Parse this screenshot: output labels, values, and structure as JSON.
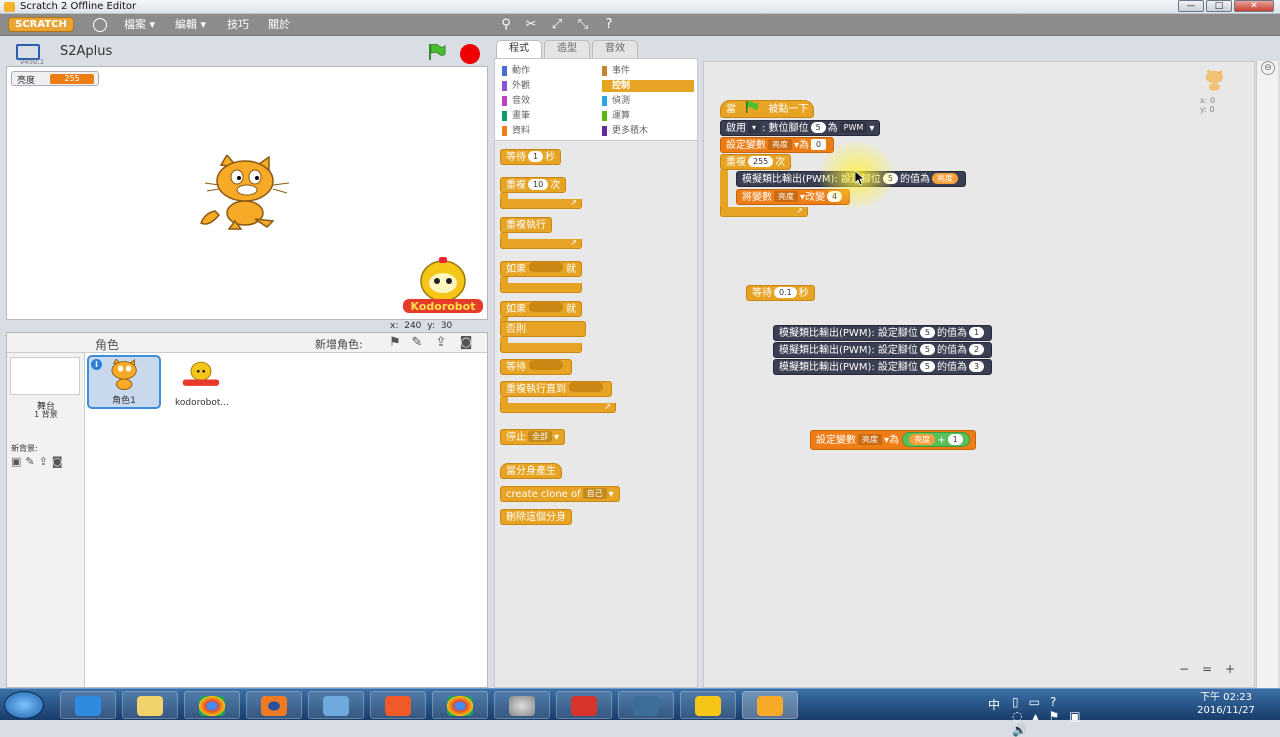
{
  "window": {
    "title": "Scratch 2 Offline Editor",
    "buttons": {
      "minimize": "—",
      "maximize": "□",
      "close": "✕"
    }
  },
  "menubar": {
    "logo": "SCRATCH",
    "menus": [
      "檔案 ▾",
      "編輯 ▾",
      "技巧",
      "關於"
    ],
    "tools": [
      "duplicate-tool",
      "delete-tool",
      "grow-tool",
      "shrink-tool",
      "help-tool"
    ]
  },
  "stage": {
    "project_name": "S2Aplus",
    "version": "v450.1",
    "monitor": {
      "label": "亮度",
      "value": "255"
    },
    "coords": "x: 240   y: 30"
  },
  "sprites": {
    "header": "角色",
    "new_sprite": "新增角色:",
    "stage_name": "舞台",
    "stage_backdrops": "1 背景",
    "new_backdrop": "新背景:",
    "items": [
      {
        "name": "角色1",
        "selected": true
      },
      {
        "name": "kodorobot..."
      }
    ]
  },
  "tabs": [
    "程式",
    "造型",
    "音效"
  ],
  "categories": [
    {
      "label": "動作",
      "color": "#4a6cd4"
    },
    {
      "label": "事件",
      "color": "#c88330"
    },
    {
      "label": "外觀",
      "color": "#8a55d7"
    },
    {
      "label": "控制",
      "color": "#e1a91a",
      "active": true
    },
    {
      "label": "音效",
      "color": "#bb42c3"
    },
    {
      "label": "偵測",
      "color": "#2ca5e2"
    },
    {
      "label": "畫筆",
      "color": "#0e9a6c"
    },
    {
      "label": "運算",
      "color": "#5cb712"
    },
    {
      "label": "資料",
      "color": "#ee7d16"
    },
    {
      "label": "更多積木",
      "color": "#632d99"
    }
  ],
  "palette": {
    "wait": "等待",
    "wait_val": "1",
    "wait_unit": "秒",
    "repeat": "重複",
    "repeat_val": "10",
    "repeat_unit": "次",
    "forever": "重複執行",
    "if": "如果",
    "then": "就",
    "if2": "如果",
    "then2": "就",
    "else": "否則",
    "wait_until": "等待",
    "repeat_until": "重複執行直到",
    "stop": "停止",
    "stop_opt": "全部",
    "clone_start": "當分身產生",
    "create_clone": "create clone of",
    "create_clone_opt": "自己",
    "delete_clone": "刪除這個分身"
  },
  "script": {
    "hat": "當",
    "hat2": "被點一下",
    "enable": "啟用",
    "enable2": ": 數位腳位",
    "enable_pin": "5",
    "enable3": "為",
    "enable_mode": "PWM",
    "setvar": "設定變數",
    "setvar_var": "亮度",
    "setvar_to": "為",
    "setvar_val": "0",
    "repeat": "重複",
    "repeat_val": "255",
    "repeat_unit": "次",
    "analog": "模擬類比輸出(PWM): 設定腳位",
    "analog_pin": "5",
    "analog_to": "的值為",
    "analog_val": "亮度",
    "change": "將變數",
    "change_var": "亮度",
    "change_by": "改變",
    "change_val": "4",
    "wait": "等待",
    "wait_val": "0.1",
    "wait_unit": "秒",
    "loose": [
      {
        "text": "模擬類比輸出(PWM): 設定腳位",
        "pin": "5",
        "to": "的值為",
        "val": "1"
      },
      {
        "text": "模擬類比輸出(PWM): 設定腳位",
        "pin": "5",
        "to": "的值為",
        "val": "2"
      },
      {
        "text": "模擬類比輸出(PWM): 設定腳位",
        "pin": "5",
        "to": "的值為",
        "val": "3"
      }
    ],
    "set2": "設定變數",
    "set2_var": "亮度",
    "set2_to": "為",
    "set2_a": "亮度",
    "set2_op": "+",
    "set2_b": "1"
  },
  "sprite_info": {
    "x": "x: 0",
    "y": "y: 0"
  },
  "zoom": [
    "−",
    "=",
    "+"
  ],
  "taskbar": {
    "tray_lang": "中",
    "time": "下午 02:23",
    "date": "2016/11/27"
  }
}
